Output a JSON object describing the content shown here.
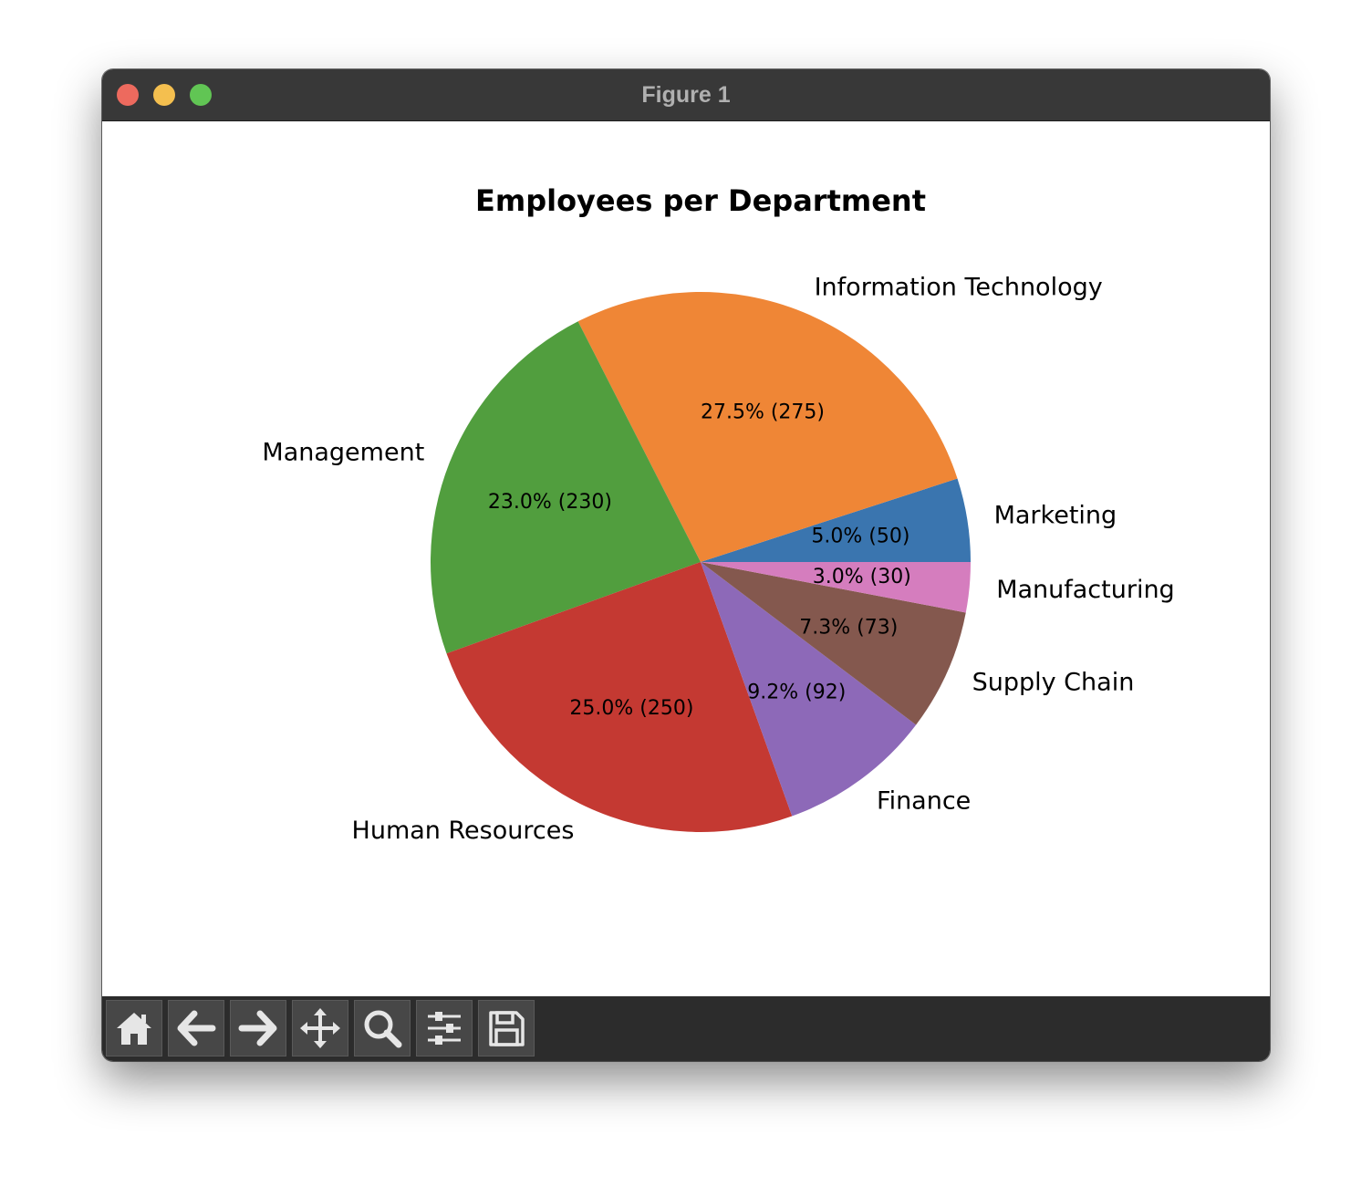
{
  "window": {
    "title": "Figure 1"
  },
  "toolbar": {
    "tools": [
      {
        "icon": "home-icon"
      },
      {
        "icon": "back-arrow-icon"
      },
      {
        "icon": "forward-arrow-icon"
      },
      {
        "icon": "pan-move-icon"
      },
      {
        "icon": "zoom-magnifier-icon"
      },
      {
        "icon": "configure-subplots-icon"
      },
      {
        "icon": "save-disk-icon"
      }
    ]
  },
  "chart_data": {
    "type": "pie",
    "title": "Employees per Department",
    "start_angle_deg": 0,
    "direction": "counterclockwise",
    "slices": [
      {
        "label": "Marketing",
        "value": 50,
        "pct_label": "5.0% (50)",
        "color": "#3a75af"
      },
      {
        "label": "Information Technology",
        "value": 275,
        "pct_label": "27.5% (275)",
        "color": "#ef8636"
      },
      {
        "label": "Management",
        "value": 230,
        "pct_label": "23.0% (230)",
        "color": "#519e3e"
      },
      {
        "label": "Human Resources",
        "value": 250,
        "pct_label": "25.0% (250)",
        "color": "#c43932"
      },
      {
        "label": "Finance",
        "value": 92,
        "pct_label": "9.2% (92)",
        "color": "#8d69b8"
      },
      {
        "label": "Supply Chain",
        "value": 73,
        "pct_label": "7.3% (73)",
        "color": "#84584e"
      },
      {
        "label": "Manufacturing",
        "value": 30,
        "pct_label": "3.0% (30)",
        "color": "#d57dbe"
      }
    ]
  }
}
